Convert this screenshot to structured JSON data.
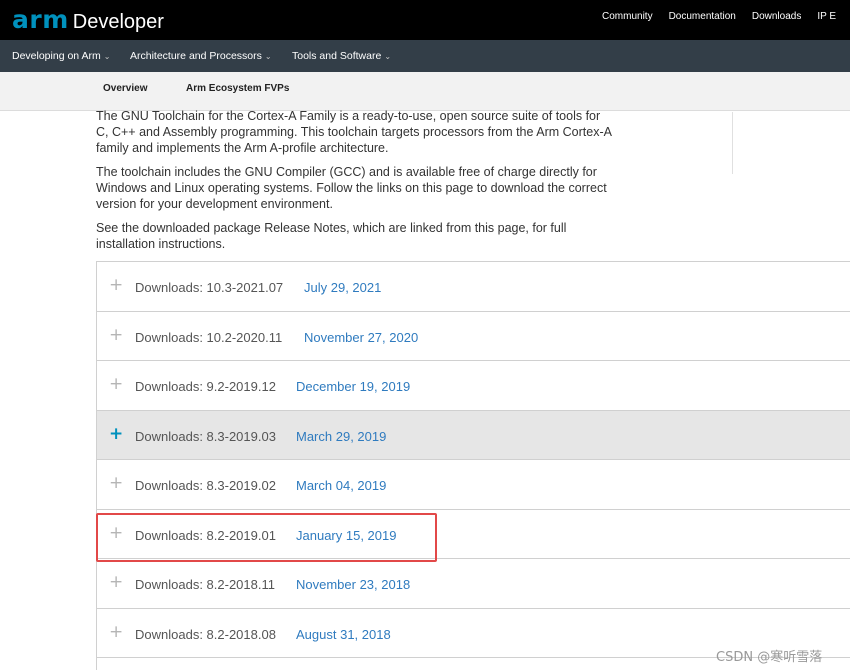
{
  "header": {
    "logo_arm": "arm",
    "logo_developer": "Developer",
    "links": [
      "Community",
      "Documentation",
      "Downloads",
      "IP E"
    ]
  },
  "nav": {
    "items": [
      "Developing on Arm",
      "Architecture and Processors",
      "Tools and Software"
    ]
  },
  "subnav": {
    "items": [
      "Overview",
      "Arm Ecosystem FVPs"
    ]
  },
  "intro": {
    "p1": "The GNU Toolchain for the Cortex-A Family is a ready-to-use, open source suite of tools for C, C++ and Assembly programming. This toolchain targets processors from the Arm Cortex-A family and implements the Arm A-profile architecture.",
    "p2": "The toolchain includes the GNU Compiler (GCC) and is available free of charge directly for Windows and Linux operating systems. Follow the links on this page to download the correct version for your development environment.",
    "p3": "See the downloaded package Release Notes, which are linked from this page, for full installation instructions."
  },
  "downloads": [
    {
      "label": "Downloads: 10.3-2021.07",
      "date": "July 29, 2021"
    },
    {
      "label": "Downloads: 10.2-2020.11",
      "date": "November 27, 2020"
    },
    {
      "label": "Downloads: 9.2-2019.12",
      "date": "December 19, 2019"
    },
    {
      "label": "Downloads: 8.3-2019.03",
      "date": "March 29, 2019"
    },
    {
      "label": "Downloads: 8.3-2019.02",
      "date": "March 04, 2019"
    },
    {
      "label": "Downloads: 8.2-2019.01",
      "date": "January 15, 2019"
    },
    {
      "label": "Downloads: 8.2-2018.11",
      "date": "November 23, 2018"
    },
    {
      "label": "Downloads: 8.2-2018.08",
      "date": "August 31, 2018"
    }
  ],
  "icons": {
    "expand": "plus-icon",
    "nav_chevron": "chevron-down-icon"
  },
  "colors": {
    "brand": "#0091bd",
    "link": "#2f7bbf",
    "highlight_box": "#e24848",
    "nav_bg": "#333e48"
  },
  "watermark": "CSDN @寒听雪落"
}
